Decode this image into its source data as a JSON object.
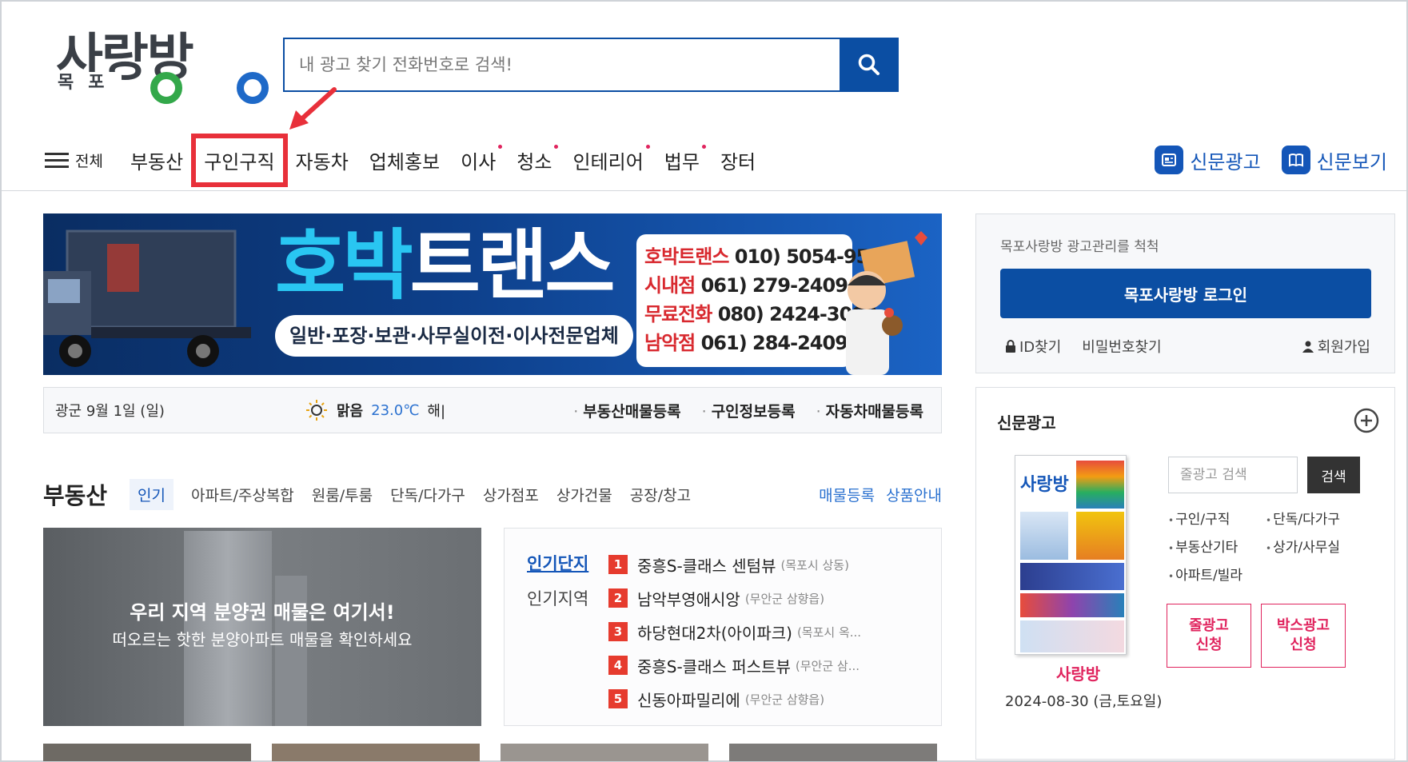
{
  "logo": {
    "main": "사랑방",
    "sub": "목포"
  },
  "search": {
    "placeholder": "내 광고 찾기 전화번호로 검색!"
  },
  "nav": {
    "all_label": "전체",
    "items": [
      {
        "label": "부동산"
      },
      {
        "label": "구인구직"
      },
      {
        "label": "자동차"
      },
      {
        "label": "업체홍보"
      },
      {
        "label": "이사"
      },
      {
        "label": "청소"
      },
      {
        "label": "인테리어"
      },
      {
        "label": "법무"
      },
      {
        "label": "장터"
      }
    ],
    "right": [
      {
        "label": "신문광고"
      },
      {
        "label": "신문보기"
      }
    ]
  },
  "banner": {
    "title_a": "호박",
    "title_b": "트랜스",
    "subtitle": "일반·포장·보관·사무실이전·이사전문업체",
    "phones": [
      {
        "name": "호박트랜스",
        "number": "010) 5054-9562"
      },
      {
        "name": "시내점",
        "number": "061) 279-2409"
      },
      {
        "name": "무료전화",
        "number": "080) 2424-3000"
      },
      {
        "name": "남악점",
        "number": "061) 284-2409"
      }
    ]
  },
  "strip": {
    "date": "광군 9월 1일 (일)",
    "weather": "맑음",
    "temp": "23.0℃",
    "extra": "해|",
    "links": [
      "부동산매물등록",
      "구인정보등록",
      "자동차매물등록"
    ]
  },
  "realestate": {
    "title": "부동산",
    "tabs": [
      "인기",
      "아파트/주상복합",
      "원룸/투룸",
      "단독/다가구",
      "상가점포",
      "상가건물",
      "공장/창고"
    ],
    "links": [
      "매물등록",
      "상품안내"
    ],
    "promo_line1": "우리 지역 분양권 매물은 여기서!",
    "promo_line2": "떠오르는 핫한 분양아파트 매물을 확인하세요",
    "popular_tab1": "인기단지",
    "popular_tab2": "인기지역",
    "popular": [
      {
        "rank": "1",
        "name": "중흥S-클래스 센텀뷰",
        "loc": "(목포시 상동)"
      },
      {
        "rank": "2",
        "name": "남악부영애시앙",
        "loc": "(무안군 삼향읍)"
      },
      {
        "rank": "3",
        "name": "하당현대2차(아이파크)",
        "loc": "(목포시 옥..."
      },
      {
        "rank": "4",
        "name": "중흥S-클래스 퍼스트뷰",
        "loc": "(무안군 삼..."
      },
      {
        "rank": "5",
        "name": "신동아파밀리에",
        "loc": "(무안군 삼향읍)"
      }
    ]
  },
  "login": {
    "title": "목포사랑방 광고관리를 척척",
    "button": "목포사랑방 로그인",
    "find_id": "ID찾기",
    "find_pw": "비밀번호찾기",
    "join": "회원가입"
  },
  "newspaper": {
    "title": "신문광고",
    "paper_name": "사랑방",
    "paper_date": "2024-08-30 (금,토요일)",
    "search_placeholder": "줄광고 검색",
    "search_button": "검색",
    "categories": [
      "구인/구직",
      "단독/다가구",
      "부동산기타",
      "상가/사무실",
      "아파트/빌라"
    ],
    "apply_line": "줄광고 신청",
    "apply_line_a": "줄광고",
    "apply_box_a": "박스광고",
    "apply_b": "신청"
  },
  "colors": {
    "brand_blue": "#0b4ea3",
    "accent_red": "#e8303a",
    "link_blue": "#1456b8"
  }
}
